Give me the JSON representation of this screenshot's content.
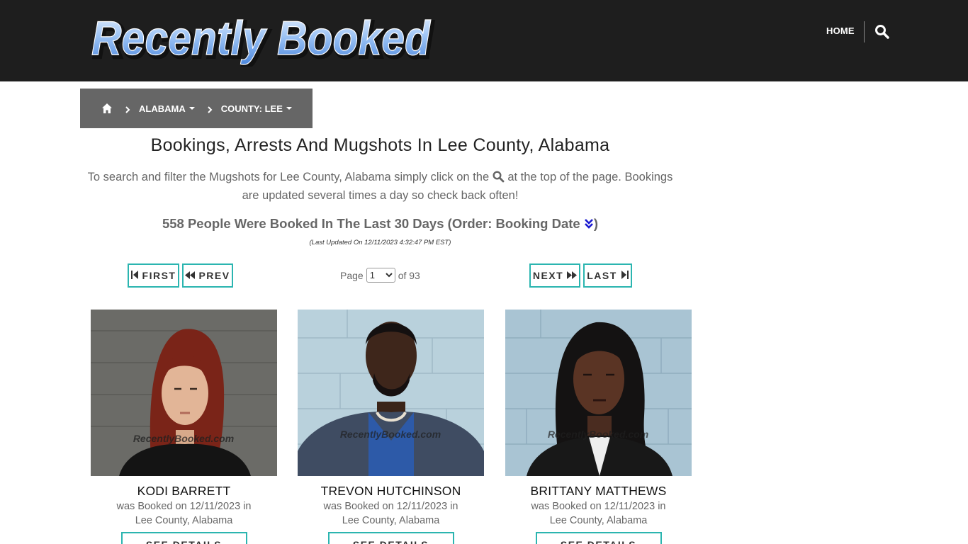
{
  "header": {
    "logo_text": "Recently Booked",
    "nav_home": "HOME",
    "search_icon": "search-icon"
  },
  "breadcrumb": {
    "home_icon": "home-icon",
    "items": [
      {
        "label": "ALABAMA"
      },
      {
        "label": "COUNTY: LEE"
      }
    ]
  },
  "main": {
    "title": "Bookings, Arrests And Mugshots In Lee County, Alabama",
    "intro_before": "To search and filter the Mugshots for Lee County, Alabama simply click on the",
    "intro_after": "at the top of the page. Bookings are updated several times a day so check back often!",
    "count_text": "558 People Were Booked In The Last 30 Days (Order: Booking Date",
    "count_close": ")",
    "last_updated": "(Last Updated On 12/11/2023 4:32:47 PM EST)"
  },
  "pager": {
    "first": "FIRST",
    "prev": "PREV",
    "next": "NEXT",
    "last": "LAST",
    "page_label": "Page",
    "current_page": "1",
    "of_label": "of 93"
  },
  "colors": {
    "header_bg": "#1e1e1e",
    "breadcrumb_bg": "#666666",
    "accent_teal": "#2bb5b0",
    "order_icon": "#1a1ad0"
  },
  "bookings": [
    {
      "name": "KODI BARRETT",
      "line1": "was Booked on 12/11/2023 in",
      "line2": "Lee County, Alabama",
      "button": "SEE DETAILS",
      "watermark": "RecentlyBooked.com"
    },
    {
      "name": "TREVON HUTCHINSON",
      "line1": "was Booked on 12/11/2023 in",
      "line2": "Lee County, Alabama",
      "button": "SEE DETAILS",
      "watermark": "RecentlyBooked.com"
    },
    {
      "name": "BRITTANY MATTHEWS",
      "line1": "was Booked on 12/11/2023 in",
      "line2": "Lee County, Alabama",
      "button": "SEE DETAILS",
      "watermark": "RecentlyBooked.com"
    }
  ]
}
